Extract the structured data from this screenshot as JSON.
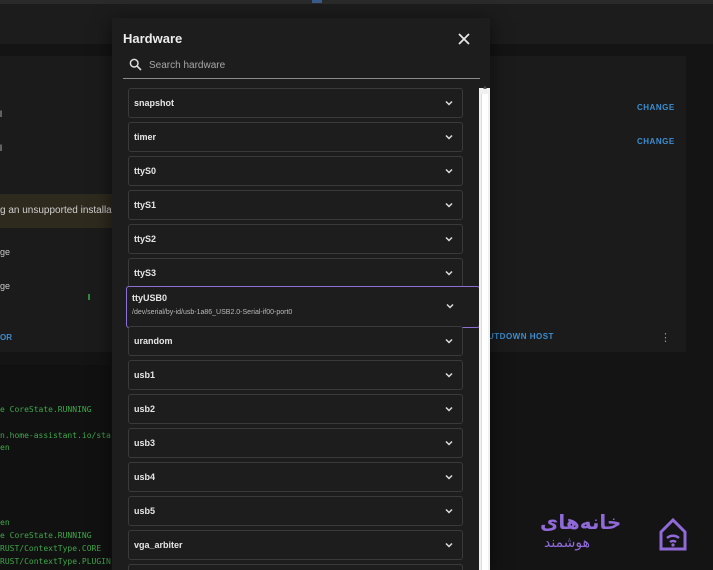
{
  "dialog": {
    "title": "Hardware",
    "search_placeholder": "Search hardware",
    "items": [
      {
        "label": "snapshot"
      },
      {
        "label": "timer"
      },
      {
        "label": "ttyS0"
      },
      {
        "label": "ttyS1"
      },
      {
        "label": "ttyS2"
      },
      {
        "label": "ttyS3"
      },
      {
        "label": "ttyUSB0",
        "subtitle": "/dev/serial/by-id/usb-1a86_USB2.0-Serial-if00-port0",
        "selected": true
      },
      {
        "label": "urandom"
      },
      {
        "label": "usb1"
      },
      {
        "label": "usb2"
      },
      {
        "label": "usb3"
      },
      {
        "label": "usb4"
      },
      {
        "label": "usb5"
      },
      {
        "label": "vga_arbiter"
      }
    ]
  },
  "background": {
    "warning_text": "g an unsupported installation",
    "row_label_1": "ge",
    "row_label_2": "ge",
    "change_1": "CHANGE",
    "change_2": "CHANGE",
    "left_action": "OR",
    "shutdown": "UTDOWN HOST",
    "logs": [
      "e CoreState.RUNNING",
      "n.home-assistant.io/sta",
      "en",
      "en",
      "e CoreState.RUNNING",
      "RUST/ContextType.CORE",
      "RUST/ContextType.PLUGIN"
    ]
  },
  "watermark": {
    "line1": "خانه‌های",
    "line2": "هوشمند"
  },
  "colors": {
    "accent_purple": "#8d6fd6",
    "link_blue": "#3b8ed0",
    "log_green": "#3fa64a"
  }
}
